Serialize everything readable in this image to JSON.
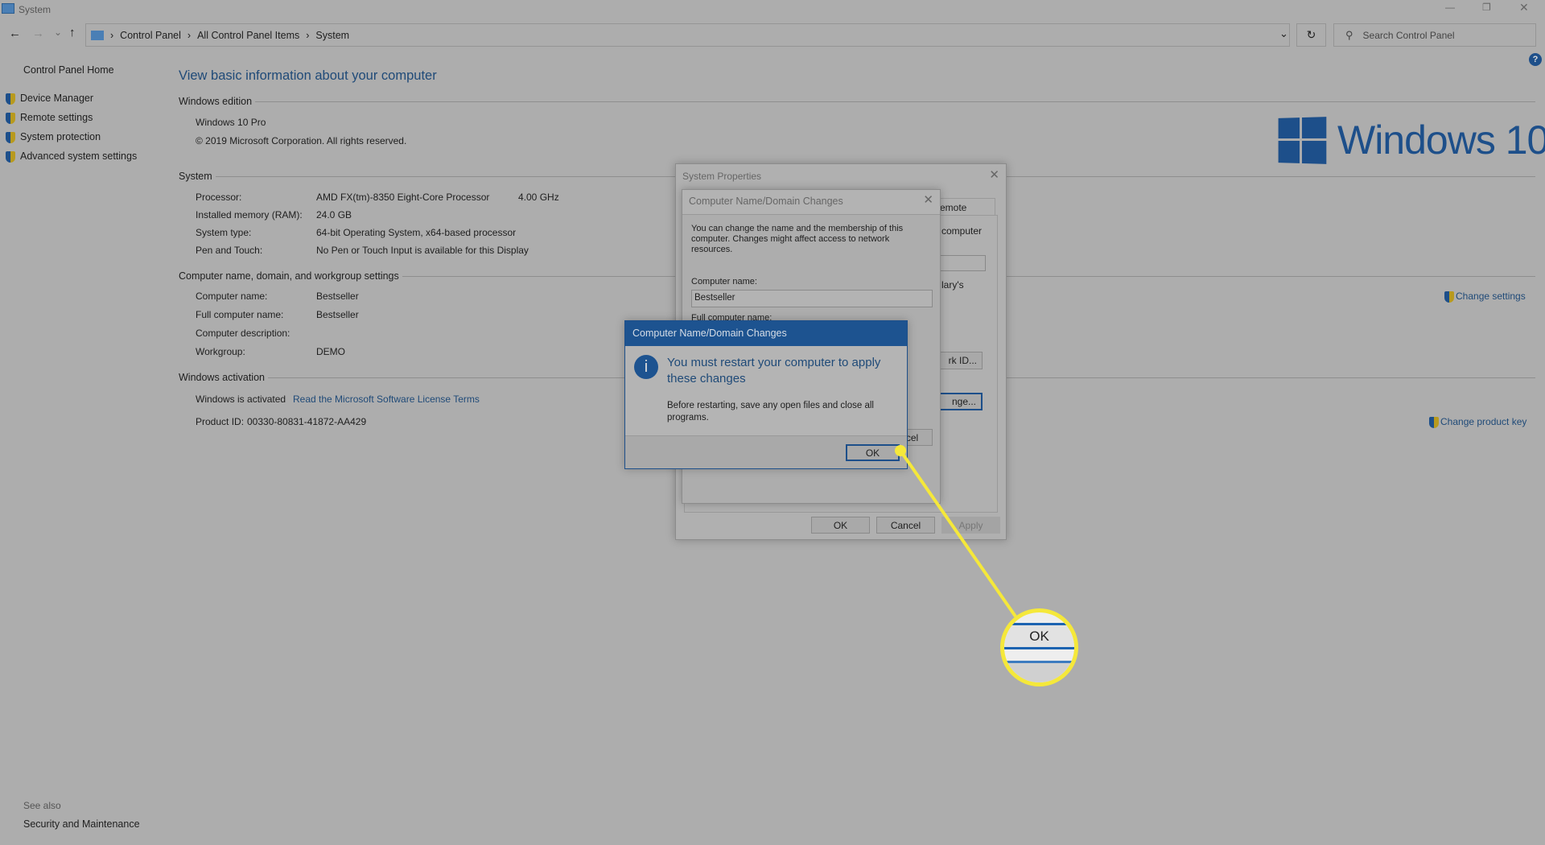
{
  "window": {
    "title": "System",
    "minimize": "—",
    "restore": "❐",
    "close": "✕"
  },
  "nav": {
    "back": "←",
    "forward": "→",
    "recent": "⌄",
    "up": "↑",
    "breadcrumb": [
      "Control Panel",
      "All Control Panel Items",
      "System"
    ],
    "refresh": "↻",
    "dropdown": "⌄"
  },
  "search": {
    "placeholder": "Search Control Panel"
  },
  "help": "?",
  "sidebar": {
    "home": "Control Panel Home",
    "items": [
      {
        "label": "Device Manager"
      },
      {
        "label": "Remote settings"
      },
      {
        "label": "System protection"
      },
      {
        "label": "Advanced system settings"
      }
    ],
    "see_also": "See also",
    "see_also_items": [
      {
        "label": "Security and Maintenance"
      }
    ]
  },
  "main": {
    "title": "View basic information about your computer",
    "edition": {
      "header": "Windows edition",
      "name": "Windows 10 Pro",
      "copyright": "© 2019 Microsoft Corporation. All rights reserved."
    },
    "logo": {
      "text": "Windows 10",
      "color": "#1d4f8a"
    },
    "system": {
      "header": "System",
      "rows": [
        {
          "label": "Processor:",
          "value": "AMD FX(tm)-8350 Eight-Core Processor",
          "extra": "4.00 GHz"
        },
        {
          "label": "Installed memory (RAM):",
          "value": "24.0 GB"
        },
        {
          "label": "System type:",
          "value": "64-bit Operating System, x64-based processor"
        },
        {
          "label": "Pen and Touch:",
          "value": "No Pen or Touch Input is available for this Display"
        }
      ]
    },
    "computer": {
      "header": "Computer name, domain, and workgroup settings",
      "change_settings": "Change settings",
      "rows": [
        {
          "label": "Computer name:",
          "value": "Bestseller"
        },
        {
          "label": "Full computer name:",
          "value": "Bestseller"
        },
        {
          "label": "Computer description:",
          "value": ""
        },
        {
          "label": "Workgroup:",
          "value": "DEMO"
        }
      ]
    },
    "activation": {
      "header": "Windows activation",
      "status": "Windows is activated",
      "license_link": "Read the Microsoft Software License Terms",
      "product_id_label": "Product ID:",
      "product_id": "00330-80831-41872-AA429",
      "change_key": "Change product key"
    }
  },
  "system_properties": {
    "title": "System Properties",
    "tab_partial": "emote",
    "partial_text_1": "computer",
    "partial_text_2": "lary's",
    "partial_btn_1": "rk ID...",
    "partial_btn_2": "nge...",
    "ok": "OK",
    "cancel": "Cancel",
    "apply": "Apply"
  },
  "name_changes": {
    "title": "Computer Name/Domain Changes",
    "description": "You can change the name and the membership of this computer. Changes might affect access to network resources.",
    "computer_name_label": "Computer name:",
    "computer_name_value": "Bestseller",
    "full_name_label": "Full computer name:",
    "partial_btn": "...",
    "ok": "OK",
    "cancel": "Cancel"
  },
  "restart_dialog": {
    "title": "Computer Name/Domain Changes",
    "icon": "i",
    "message": "You must restart your computer to apply these changes",
    "detail": "Before restarting, save any open files and close all programs.",
    "ok": "OK"
  },
  "callout": {
    "label": "OK",
    "color": "#f5e83a"
  }
}
